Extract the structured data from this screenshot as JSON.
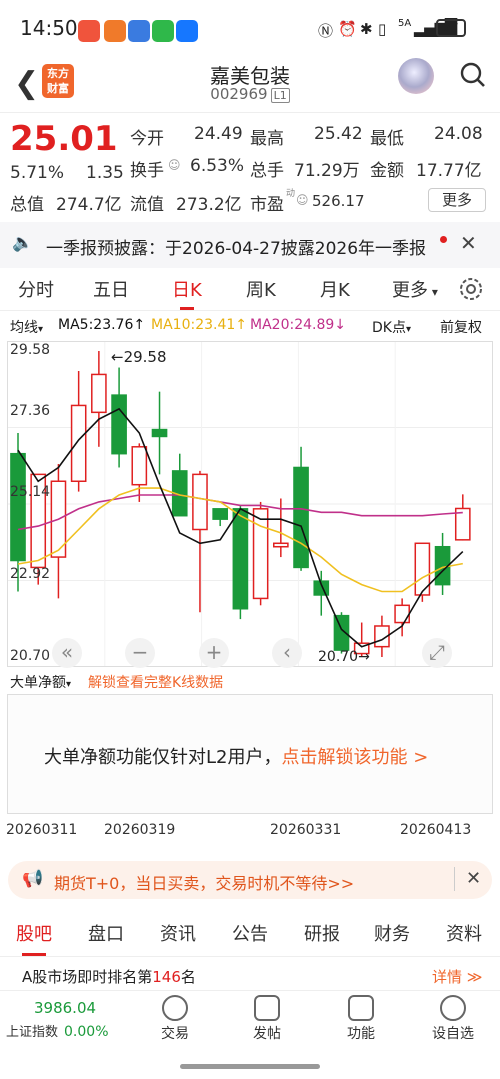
{
  "status": {
    "time": "14:50",
    "battery": "27",
    "network": "5A"
  },
  "header": {
    "logo_line1": "东方",
    "logo_line2": "财富",
    "title": "嘉美包装",
    "code": "002969",
    "market": "L1"
  },
  "quote": {
    "price": "25.01",
    "change_pct": "5.71%",
    "change": "1.35",
    "open_label": "今开",
    "open": "24.49",
    "high_label": "最高",
    "high": "25.42",
    "low_label": "最低",
    "low": "24.08",
    "turnover_label": "换手",
    "turnover": "6.53%",
    "volume_label": "总手",
    "volume": "71.29万",
    "amount_label": "金额",
    "amount": "17.77亿",
    "mktcap_label": "总值",
    "mktcap": "274.7亿",
    "float_label": "流值",
    "float": "273.2亿",
    "pe_label": "市盈",
    "pe_sup": "动",
    "pe": "526.17",
    "more": "更多"
  },
  "notice": {
    "text": "一季报预披露：于2026-04-27披露2026年一季报"
  },
  "tabs": [
    "分时",
    "五日",
    "日K",
    "周K",
    "月K",
    "更多"
  ],
  "active_tab": "日K",
  "ma": {
    "label": "均线",
    "ma5": "MA5:23.76↑",
    "ma10": "MA10:23.41↑",
    "ma20": "MA20:24.89↓",
    "dk": "DK点",
    "adjust": "前复权"
  },
  "colors": {
    "up": "#e02020",
    "down": "#1a9a3a",
    "ma5": "#111111",
    "ma10": "#f0c020",
    "ma20": "#c0308a",
    "accent": "#f0662c"
  },
  "chart_data": {
    "type": "candlestick",
    "y_ticks": [
      "29.58",
      "27.36",
      "25.14",
      "22.92",
      "20.70"
    ],
    "ylim": [
      20.7,
      29.58
    ],
    "high_marker": "←29.58",
    "low_marker": "20.70→",
    "candles": [
      {
        "o": 26.6,
        "h": 27.2,
        "l": 22.6,
        "c": 23.5
      },
      {
        "o": 23.3,
        "h": 26.0,
        "l": 22.8,
        "c": 26.0
      },
      {
        "o": 23.6,
        "h": 26.3,
        "l": 22.4,
        "c": 25.8
      },
      {
        "o": 25.8,
        "h": 29.0,
        "l": 25.5,
        "c": 28.0
      },
      {
        "o": 27.8,
        "h": 29.58,
        "l": 26.8,
        "c": 28.9
      },
      {
        "o": 28.3,
        "h": 29.1,
        "l": 26.2,
        "c": 26.6
      },
      {
        "o": 25.7,
        "h": 26.9,
        "l": 25.2,
        "c": 26.8
      },
      {
        "o": 27.3,
        "h": 28.4,
        "l": 26.0,
        "c": 27.1
      },
      {
        "o": 26.1,
        "h": 26.6,
        "l": 24.8,
        "c": 24.8
      },
      {
        "o": 24.4,
        "h": 26.1,
        "l": 22.0,
        "c": 26.0
      },
      {
        "o": 25.0,
        "h": 25.0,
        "l": 24.5,
        "c": 24.7
      },
      {
        "o": 25.0,
        "h": 25.1,
        "l": 21.8,
        "c": 22.1
      },
      {
        "o": 22.4,
        "h": 25.2,
        "l": 22.2,
        "c": 25.0
      },
      {
        "o": 23.9,
        "h": 25.3,
        "l": 23.6,
        "c": 24.0
      },
      {
        "o": 26.2,
        "h": 26.8,
        "l": 23.2,
        "c": 23.3
      },
      {
        "o": 22.9,
        "h": 23.2,
        "l": 21.9,
        "c": 22.5
      },
      {
        "o": 21.9,
        "h": 22.0,
        "l": 20.8,
        "c": 20.9
      },
      {
        "o": 20.8,
        "h": 21.7,
        "l": 20.7,
        "c": 21.1
      },
      {
        "o": 21.0,
        "h": 21.9,
        "l": 20.7,
        "c": 21.6
      },
      {
        "o": 21.7,
        "h": 22.4,
        "l": 21.3,
        "c": 22.2
      },
      {
        "o": 22.5,
        "h": 24.0,
        "l": 22.3,
        "c": 24.0
      },
      {
        "o": 23.9,
        "h": 24.3,
        "l": 22.5,
        "c": 22.8
      },
      {
        "o": 24.1,
        "h": 25.42,
        "l": 24.08,
        "c": 25.01
      }
    ],
    "ma5": [
      26.7,
      25.8,
      26.2,
      27.0,
      27.6,
      27.9,
      27.2,
      25.7,
      24.3,
      24.0,
      24.1,
      25.0,
      24.7,
      24.7,
      24.5,
      22.8,
      21.5,
      21.0,
      21.2,
      21.6,
      22.6,
      23.2,
      23.76
    ],
    "ma10": [
      23.4,
      23.5,
      23.8,
      24.4,
      25.0,
      25.4,
      25.6,
      25.6,
      25.4,
      25.3,
      25.2,
      24.8,
      24.5,
      24.3,
      24.0,
      23.6,
      23.1,
      22.8,
      22.6,
      22.6,
      23.0,
      23.3,
      23.41
    ],
    "ma20": [
      24.4,
      24.5,
      24.7,
      25.0,
      25.2,
      25.3,
      25.4,
      25.4,
      25.4,
      25.3,
      25.2,
      25.1,
      25.1,
      25.0,
      25.0,
      24.9,
      24.9,
      24.8,
      24.8,
      24.8,
      24.8,
      24.85,
      24.89
    ],
    "x_ticks": [
      "20260311",
      "20260319",
      "20260331",
      "20260413"
    ]
  },
  "net_bar": {
    "label": "大单净额",
    "link": "解锁查看完整K线数据"
  },
  "lockbox": {
    "text": "大单净额功能仅针对L2用户，",
    "link": "点击解锁该功能 >"
  },
  "ad": {
    "text": "期货T+0，当日买卖，交易时机不等待>>"
  },
  "bottom_tabs": [
    "股吧",
    "盘口",
    "资讯",
    "公告",
    "研报",
    "财务",
    "资料"
  ],
  "rank": {
    "text_a": "A股市场即时排名第",
    "rank_num": "146",
    "text_b": "名",
    "detail": "详情 ≫"
  },
  "nav": {
    "index_value": "3986.04",
    "index_label": "上证指数",
    "index_change": "0.00%",
    "items": [
      "交易",
      "发帖",
      "功能",
      "设自选"
    ]
  }
}
